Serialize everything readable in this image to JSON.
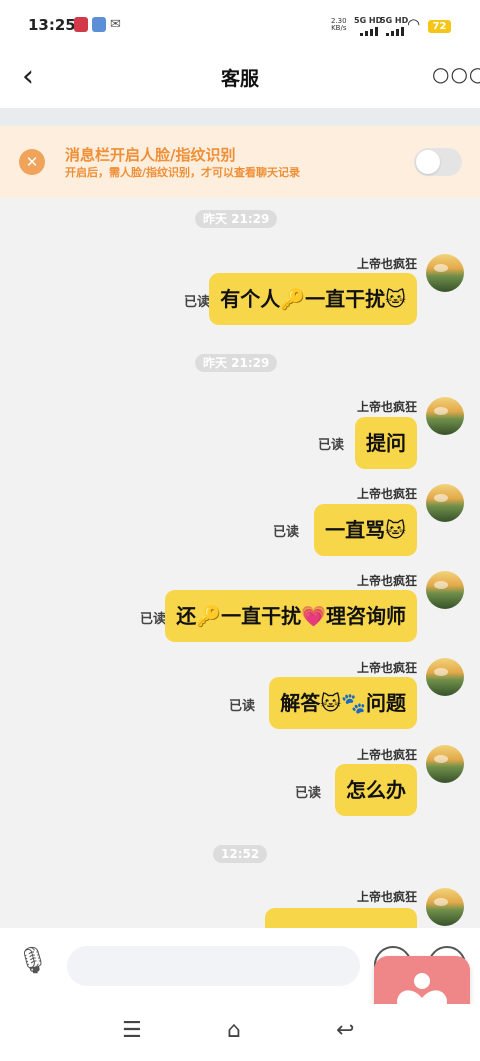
{
  "status_bar": {
    "time": "13:25",
    "net_speed": "2.30",
    "net_unit": "KB/s",
    "sim1": "5G HD",
    "sim2": "5G HD",
    "battery": "72",
    "battery_color": "#f5c518"
  },
  "header": {
    "title": "客服"
  },
  "banner": {
    "title": "消息栏开启人脸/指纹识别",
    "subtitle": "开启后，需人脸/指纹识别，才可以查看聊天记录",
    "accent": "#ef8f37",
    "toggle_on": false
  },
  "chat": {
    "timestamps": [
      "昨天 21:29",
      "昨天 21:29",
      "12:52"
    ],
    "sender_name": "上帝也疯狂",
    "read_label": "已读",
    "bubble_color": "#f7d64a",
    "messages": [
      {
        "text": "有个人🔑一直干扰🐱"
      },
      {
        "text": "提问"
      },
      {
        "text": "一直骂🐱"
      },
      {
        "text": "还🔑一直干扰💗理咨询师"
      },
      {
        "text": "解答🐱🐾问题"
      },
      {
        "text": "怎么办"
      }
    ]
  },
  "input": {
    "placeholder": ""
  },
  "icons": [
    "back-arrow-icon",
    "more-icon",
    "close-icon",
    "microphone-icon",
    "emoji-icon",
    "plus-icon",
    "heart-icon",
    "menu-icon",
    "home-icon",
    "return-icon"
  ]
}
